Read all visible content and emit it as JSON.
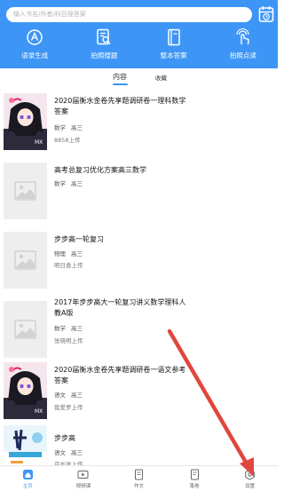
{
  "search": {
    "placeholder": "输入书名/作者/科目搜答案"
  },
  "quick_actions": [
    {
      "label": "语录生成",
      "icon": "audio-text-icon"
    },
    {
      "label": "拍照搜题",
      "icon": "photo-search-icon"
    },
    {
      "label": "整本答案",
      "icon": "book-icon"
    },
    {
      "label": "拍照点读",
      "icon": "touch-read-icon"
    }
  ],
  "tabs": {
    "content": "内容",
    "favorites": "收藏"
  },
  "items": [
    {
      "title": "2020届衡水金卷先享题调研卷一理科数学答案",
      "subject": "数学",
      "grade": "高三",
      "uploader": "8858上传",
      "thumb": "anime"
    },
    {
      "title": "高考总复习优化方案高三数学",
      "subject": "数学",
      "grade": "高三",
      "uploader": "",
      "thumb": "placeholder"
    },
    {
      "title": "步步高一轮复习",
      "subject": "物理",
      "grade": "高三",
      "uploader": "明日香上传",
      "thumb": "placeholder"
    },
    {
      "title": "2017年步步高大一轮复习讲义数学理科人教A版",
      "subject": "数学",
      "grade": "高三",
      "uploader": "张晓明上传",
      "thumb": "placeholder"
    },
    {
      "title": "2020届衡水金卷先享题调研卷一语文参考答案",
      "subject": "语文",
      "grade": "高三",
      "uploader": "我爱罗上传",
      "thumb": "anime"
    },
    {
      "title": "步步高",
      "subject": "语文",
      "grade": "高三",
      "uploader": "弓长张上传",
      "thumb": "book"
    }
  ],
  "bottom_nav": [
    {
      "label": "主页",
      "active": true
    },
    {
      "label": "视频课",
      "active": false
    },
    {
      "label": "作文",
      "active": false
    },
    {
      "label": "笔卷",
      "active": false
    },
    {
      "label": "设置",
      "active": false
    }
  ],
  "colors": {
    "accent": "#3d96f5",
    "arrow": "#e0473e"
  }
}
